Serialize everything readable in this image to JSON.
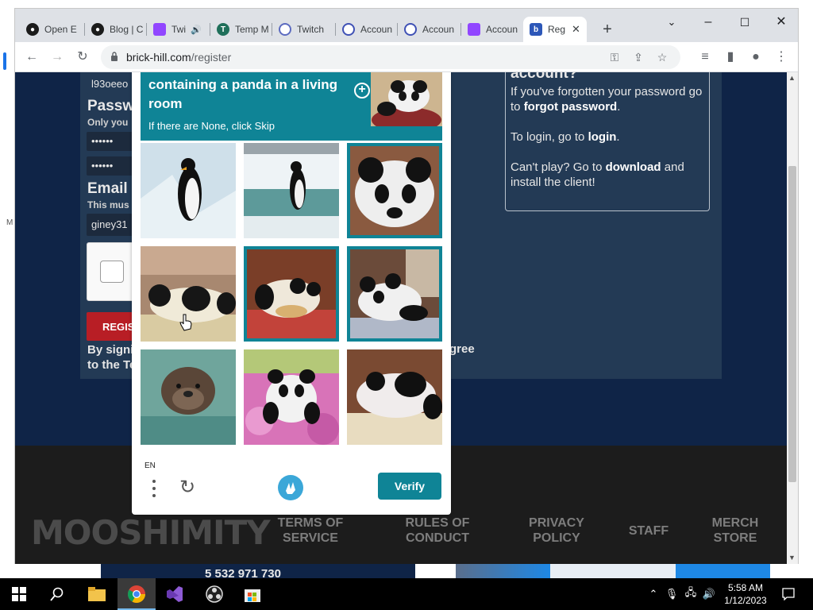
{
  "browser": {
    "tabs": [
      {
        "label": "Open E",
        "icon": "github-icon"
      },
      {
        "label": "Blog | C",
        "icon": "github-icon"
      },
      {
        "label": "Twi",
        "icon": "twitch-icon"
      },
      {
        "label": "Temp M",
        "icon": "temp-mail-icon"
      },
      {
        "label": "Twitch",
        "icon": "twitch-login-icon"
      },
      {
        "label": "Accoun",
        "icon": "account-icon"
      },
      {
        "label": "Accoun",
        "icon": "account-icon"
      },
      {
        "label": "Accoun",
        "icon": "twitch-icon"
      },
      {
        "label": "Reg",
        "icon": "brick-hill-icon"
      }
    ],
    "url_host": "brick-hill.com",
    "url_path": "/register"
  },
  "form": {
    "username_value": "l93oeeo",
    "password_label": "Passw",
    "password_hint": "Only you",
    "password_value": "••••••",
    "confirm_value": "••••••",
    "email_label": "Email",
    "email_hint": "This mus",
    "email_value": "giney31",
    "register_label": "REGIS",
    "signing_text_1": "By signi",
    "signing_text_2": "to the Te",
    "agree_text": "gree"
  },
  "sidebar": {
    "heading": "account?",
    "forgot_prefix": "If you've forgotten your password go to ",
    "forgot_link": "forgot password",
    "forgot_suffix": ".",
    "login_prefix": "To login, go to ",
    "login_link": "login",
    "login_suffix": ".",
    "download_prefix": "Can't play? Go to ",
    "download_link": "download",
    "download_suffix": " and install the client!"
  },
  "captcha": {
    "prompt": "containing a panda in a living room",
    "sub": "If there are None, click Skip",
    "language": "EN",
    "verify_label": "Verify",
    "tiles": [
      {
        "subject": "penguin on ice",
        "selected": false
      },
      {
        "subject": "penguin in snow",
        "selected": false
      },
      {
        "subject": "panda face",
        "selected": true
      },
      {
        "subject": "panda on couch",
        "selected": false
      },
      {
        "subject": "panda on red couch",
        "selected": true
      },
      {
        "subject": "panda in room",
        "selected": true
      },
      {
        "subject": "otter in water",
        "selected": false
      },
      {
        "subject": "panda in flowers",
        "selected": false
      },
      {
        "subject": "panda on sofa",
        "selected": false
      }
    ]
  },
  "footer": {
    "logo": "MOOSHIMITY",
    "links": [
      "TERMS OF SERVICE",
      "RULES OF CONDUCT",
      "PRIVACY POLICY",
      "STAFF",
      "MERCH STORE"
    ]
  },
  "under": {
    "number_text": "5 532 971 730"
  },
  "taskbar": {
    "time": "5:58 AM",
    "date": "1/12/2023"
  },
  "colors": {
    "captcha_teal": "#0f8496",
    "page_navy": "#0f2447",
    "register_red": "#b81e25"
  }
}
